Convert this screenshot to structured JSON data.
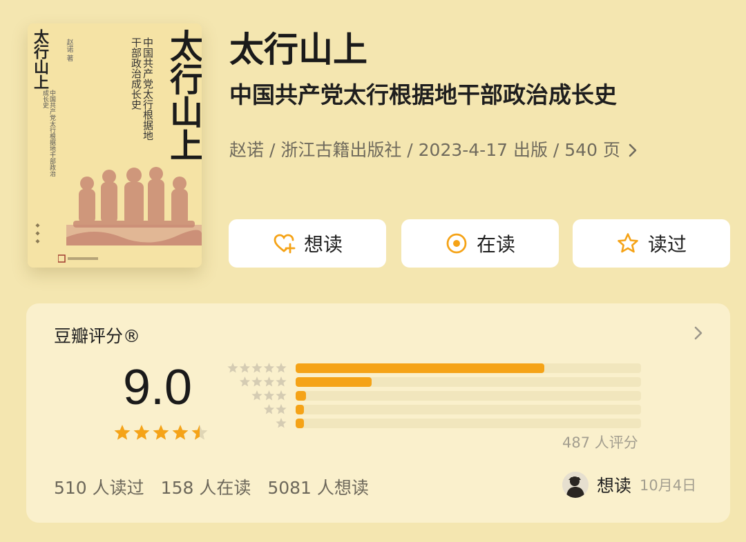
{
  "cover": {
    "title": "太行山上",
    "title_small": "太行山上",
    "subtitle": "中国共产党太行根据地干部政治成长史",
    "author_mark": "赵诺 著"
  },
  "book": {
    "title": "太行山上",
    "subtitle": "中国共产党太行根据地干部政治成长史",
    "meta": "赵诺 / 浙江古籍出版社 / 2023-4-17 出版 / 540 页"
  },
  "actions": {
    "want_label": "想读",
    "reading_label": "在读",
    "read_label": "读过"
  },
  "rating": {
    "heading": "豆瓣评分®",
    "score": "9.0",
    "stars": 4.5,
    "distribution": [
      {
        "stars": 5,
        "fraction": 0.72
      },
      {
        "stars": 4,
        "fraction": 0.22
      },
      {
        "stars": 3,
        "fraction": 0.03
      },
      {
        "stars": 2,
        "fraction": 0.02
      },
      {
        "stars": 1,
        "fraction": 0.02
      }
    ],
    "raters": "487 人评分",
    "stats": {
      "read": "510 人读过",
      "reading": "158 人在读",
      "want": "5081 人想读"
    },
    "recent_action": "想读",
    "recent_date": "10月4日"
  },
  "colors": {
    "background": "#f4e6b0",
    "accent": "#f5a317",
    "card": "#faf0cc"
  },
  "icons": {
    "want": "heart-plus-icon",
    "reading": "target-icon",
    "read": "star-outline-icon",
    "chevron": "chevron-right-icon"
  }
}
